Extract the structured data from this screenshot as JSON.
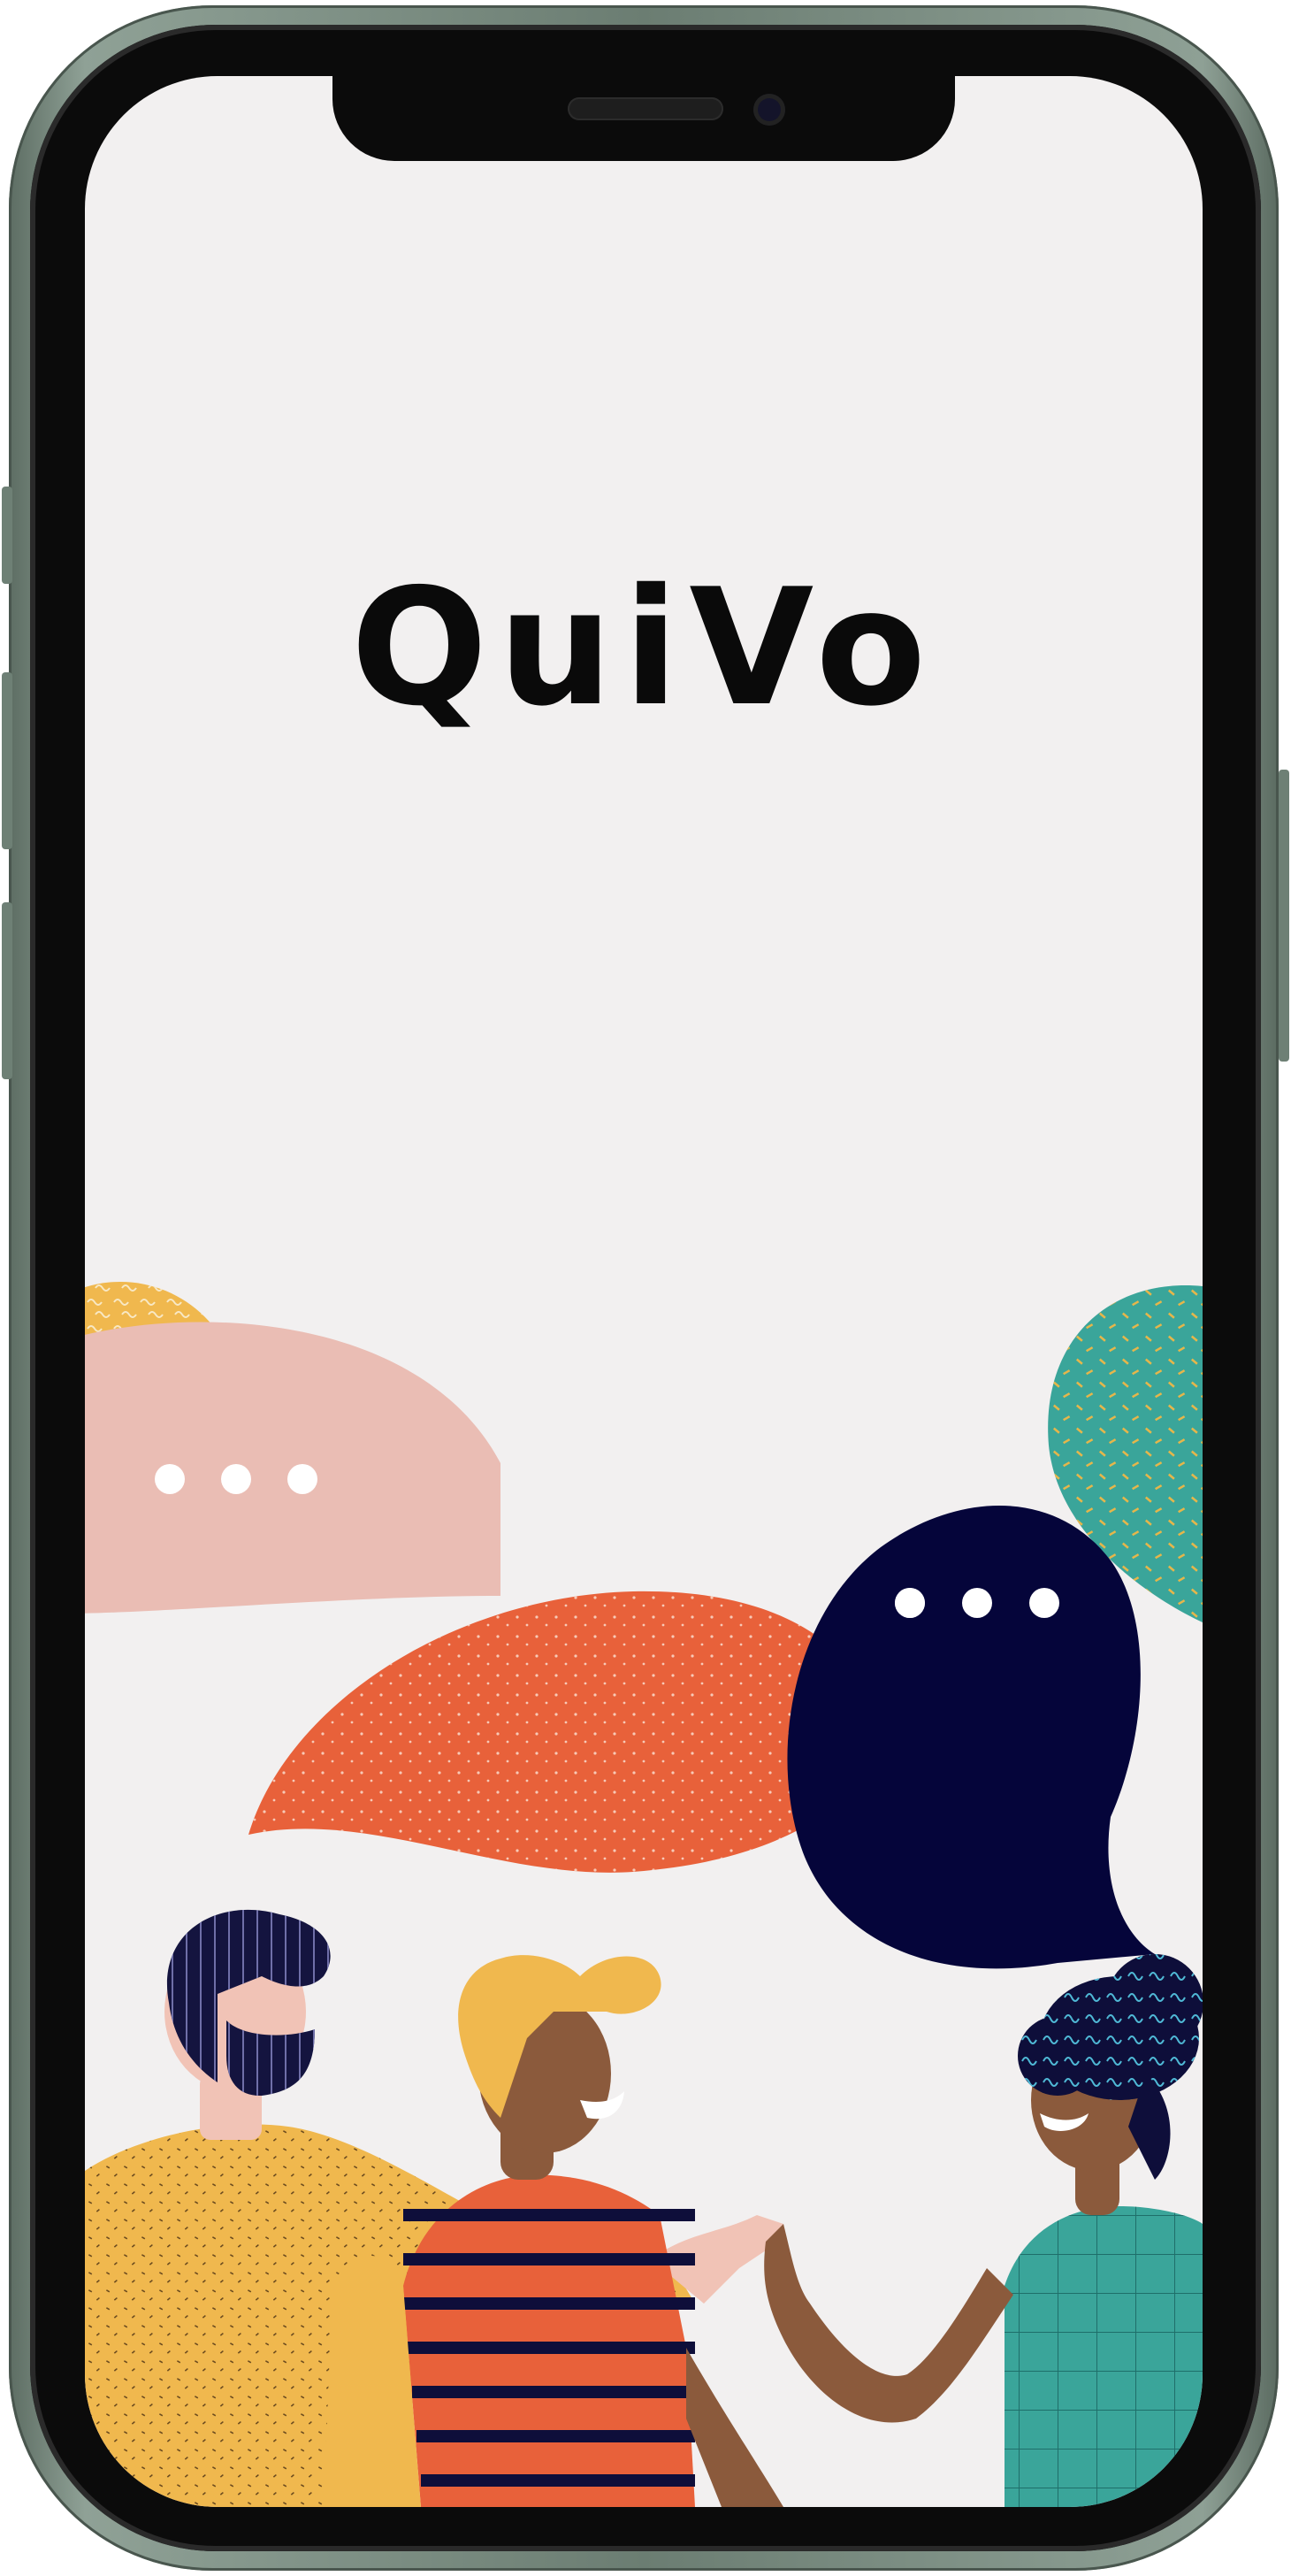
{
  "app": {
    "title": "QuiVo"
  },
  "illustration": {
    "name": "people-chatting-illustration"
  },
  "colors": {
    "background": "#f2f0f0",
    "title": "#0a0a0a",
    "orange_bubble": "#e8613a",
    "navy_bubble": "#05053a",
    "pink_bubble": "#eabdb4",
    "teal": "#3aa59a",
    "yellow": "#f0b84e",
    "frame": "#7d8f84"
  }
}
